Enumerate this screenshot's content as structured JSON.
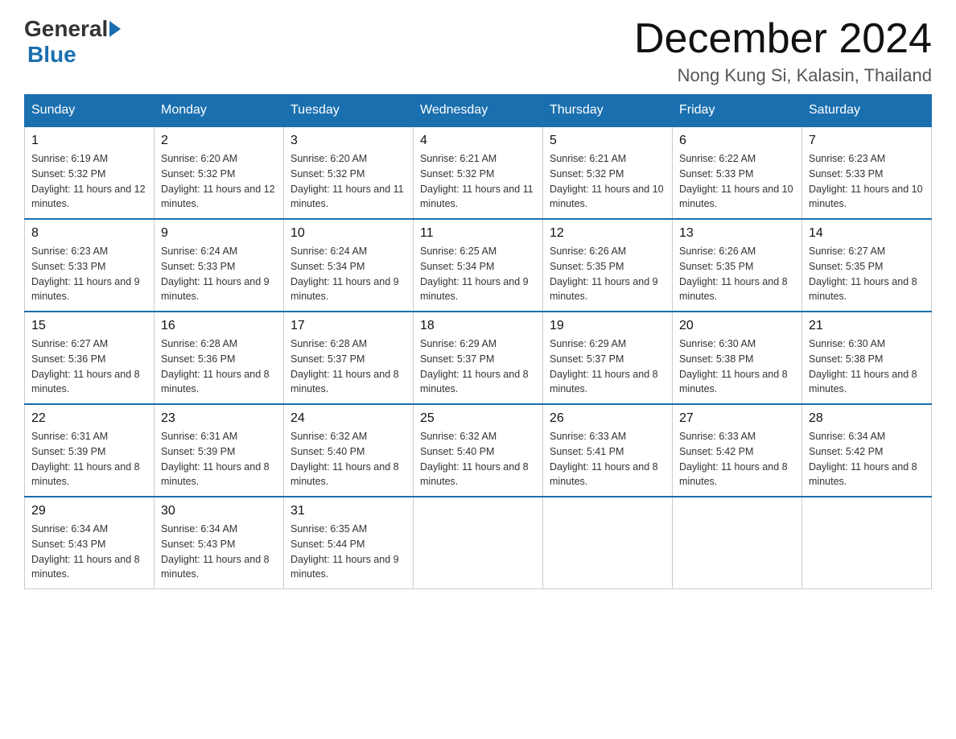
{
  "logo": {
    "general": "General",
    "blue": "Blue"
  },
  "title": "December 2024",
  "location": "Nong Kung Si, Kalasin, Thailand",
  "days_of_week": [
    "Sunday",
    "Monday",
    "Tuesday",
    "Wednesday",
    "Thursday",
    "Friday",
    "Saturday"
  ],
  "weeks": [
    [
      {
        "day": "1",
        "sunrise": "6:19 AM",
        "sunset": "5:32 PM",
        "daylight": "11 hours and 12 minutes."
      },
      {
        "day": "2",
        "sunrise": "6:20 AM",
        "sunset": "5:32 PM",
        "daylight": "11 hours and 12 minutes."
      },
      {
        "day": "3",
        "sunrise": "6:20 AM",
        "sunset": "5:32 PM",
        "daylight": "11 hours and 11 minutes."
      },
      {
        "day": "4",
        "sunrise": "6:21 AM",
        "sunset": "5:32 PM",
        "daylight": "11 hours and 11 minutes."
      },
      {
        "day": "5",
        "sunrise": "6:21 AM",
        "sunset": "5:32 PM",
        "daylight": "11 hours and 10 minutes."
      },
      {
        "day": "6",
        "sunrise": "6:22 AM",
        "sunset": "5:33 PM",
        "daylight": "11 hours and 10 minutes."
      },
      {
        "day": "7",
        "sunrise": "6:23 AM",
        "sunset": "5:33 PM",
        "daylight": "11 hours and 10 minutes."
      }
    ],
    [
      {
        "day": "8",
        "sunrise": "6:23 AM",
        "sunset": "5:33 PM",
        "daylight": "11 hours and 9 minutes."
      },
      {
        "day": "9",
        "sunrise": "6:24 AM",
        "sunset": "5:33 PM",
        "daylight": "11 hours and 9 minutes."
      },
      {
        "day": "10",
        "sunrise": "6:24 AM",
        "sunset": "5:34 PM",
        "daylight": "11 hours and 9 minutes."
      },
      {
        "day": "11",
        "sunrise": "6:25 AM",
        "sunset": "5:34 PM",
        "daylight": "11 hours and 9 minutes."
      },
      {
        "day": "12",
        "sunrise": "6:26 AM",
        "sunset": "5:35 PM",
        "daylight": "11 hours and 9 minutes."
      },
      {
        "day": "13",
        "sunrise": "6:26 AM",
        "sunset": "5:35 PM",
        "daylight": "11 hours and 8 minutes."
      },
      {
        "day": "14",
        "sunrise": "6:27 AM",
        "sunset": "5:35 PM",
        "daylight": "11 hours and 8 minutes."
      }
    ],
    [
      {
        "day": "15",
        "sunrise": "6:27 AM",
        "sunset": "5:36 PM",
        "daylight": "11 hours and 8 minutes."
      },
      {
        "day": "16",
        "sunrise": "6:28 AM",
        "sunset": "5:36 PM",
        "daylight": "11 hours and 8 minutes."
      },
      {
        "day": "17",
        "sunrise": "6:28 AM",
        "sunset": "5:37 PM",
        "daylight": "11 hours and 8 minutes."
      },
      {
        "day": "18",
        "sunrise": "6:29 AM",
        "sunset": "5:37 PM",
        "daylight": "11 hours and 8 minutes."
      },
      {
        "day": "19",
        "sunrise": "6:29 AM",
        "sunset": "5:37 PM",
        "daylight": "11 hours and 8 minutes."
      },
      {
        "day": "20",
        "sunrise": "6:30 AM",
        "sunset": "5:38 PM",
        "daylight": "11 hours and 8 minutes."
      },
      {
        "day": "21",
        "sunrise": "6:30 AM",
        "sunset": "5:38 PM",
        "daylight": "11 hours and 8 minutes."
      }
    ],
    [
      {
        "day": "22",
        "sunrise": "6:31 AM",
        "sunset": "5:39 PM",
        "daylight": "11 hours and 8 minutes."
      },
      {
        "day": "23",
        "sunrise": "6:31 AM",
        "sunset": "5:39 PM",
        "daylight": "11 hours and 8 minutes."
      },
      {
        "day": "24",
        "sunrise": "6:32 AM",
        "sunset": "5:40 PM",
        "daylight": "11 hours and 8 minutes."
      },
      {
        "day": "25",
        "sunrise": "6:32 AM",
        "sunset": "5:40 PM",
        "daylight": "11 hours and 8 minutes."
      },
      {
        "day": "26",
        "sunrise": "6:33 AM",
        "sunset": "5:41 PM",
        "daylight": "11 hours and 8 minutes."
      },
      {
        "day": "27",
        "sunrise": "6:33 AM",
        "sunset": "5:42 PM",
        "daylight": "11 hours and 8 minutes."
      },
      {
        "day": "28",
        "sunrise": "6:34 AM",
        "sunset": "5:42 PM",
        "daylight": "11 hours and 8 minutes."
      }
    ],
    [
      {
        "day": "29",
        "sunrise": "6:34 AM",
        "sunset": "5:43 PM",
        "daylight": "11 hours and 8 minutes."
      },
      {
        "day": "30",
        "sunrise": "6:34 AM",
        "sunset": "5:43 PM",
        "daylight": "11 hours and 8 minutes."
      },
      {
        "day": "31",
        "sunrise": "6:35 AM",
        "sunset": "5:44 PM",
        "daylight": "11 hours and 9 minutes."
      },
      null,
      null,
      null,
      null
    ]
  ]
}
